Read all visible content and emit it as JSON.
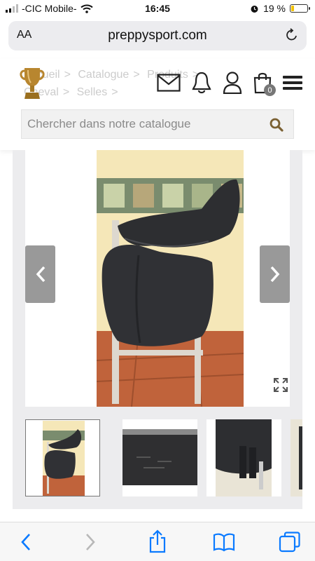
{
  "status_bar": {
    "carrier": "-CIC Mobile-",
    "time": "16:45",
    "battery_text": "19 %",
    "battery_level": 0.19,
    "colors": {
      "battery_fill": "#f2c200"
    }
  },
  "browser": {
    "text_size_label": "AA",
    "url": "preppysport.com"
  },
  "header": {
    "breadcrumb": [
      "Accueil",
      ">",
      "Catalogue",
      ">",
      "Produits",
      ">",
      "Cheval",
      ">",
      "Selles",
      ">"
    ],
    "cart_count": "0",
    "search_placeholder": "Chercher dans notre catalogue",
    "icons": [
      "trophy-logo",
      "mail-icon",
      "bell-icon",
      "user-icon",
      "shopping-bag-icon",
      "menu-icon",
      "search-icon"
    ]
  },
  "gallery": {
    "thumbnail_count": 4,
    "active_thumbnail": 1,
    "colors": {
      "background": "#ececee",
      "arrow": "#999999"
    }
  },
  "toolbar": {
    "icons": [
      "back-icon",
      "forward-icon",
      "share-icon",
      "bookmarks-icon",
      "tabs-icon"
    ],
    "colors": {
      "active": "#0a7aff",
      "disabled": "#b8b8b8"
    }
  }
}
